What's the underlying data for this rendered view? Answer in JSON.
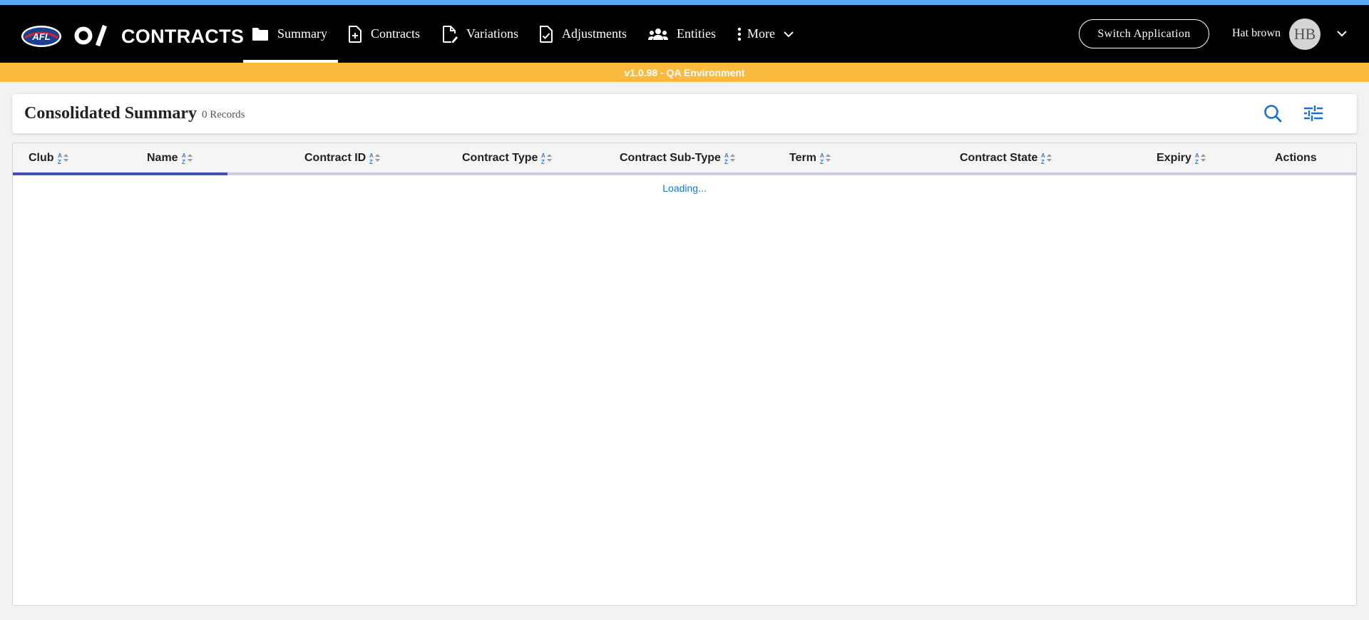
{
  "app": {
    "title": "CONTRACTS",
    "brand_logo_text": "AFL",
    "accent_color": "#5ba9f0",
    "banner_color": "#fbb93d",
    "primary_color": "#3f51b5"
  },
  "nav": {
    "items": [
      {
        "label": "Summary",
        "icon": "folder-icon",
        "active": true
      },
      {
        "label": "Contracts",
        "icon": "file-plus-icon",
        "active": false
      },
      {
        "label": "Variations",
        "icon": "file-edit-icon",
        "active": false
      },
      {
        "label": "Adjustments",
        "icon": "file-check-icon",
        "active": false
      },
      {
        "label": "Entities",
        "icon": "people-icon",
        "active": false
      },
      {
        "label": "More",
        "icon": "more-vert-icon",
        "active": false
      }
    ]
  },
  "header_actions": {
    "switch_application_label": "Switch Application",
    "user_name": "Hat brown",
    "user_initials": "HB"
  },
  "environment_banner": "v1.0.98 - QA Environment",
  "page": {
    "title": "Consolidated Summary",
    "record_count": "0 Records"
  },
  "table": {
    "columns": [
      {
        "label": "Club",
        "sortable": true
      },
      {
        "label": "Name",
        "sortable": true
      },
      {
        "label": "Contract ID",
        "sortable": true
      },
      {
        "label": "Contract Type",
        "sortable": true
      },
      {
        "label": "Contract Sub-Type",
        "sortable": true
      },
      {
        "label": "Term",
        "sortable": true
      },
      {
        "label": "Contract State",
        "sortable": true
      },
      {
        "label": "Expiry",
        "sortable": true
      },
      {
        "label": "Actions",
        "sortable": false
      }
    ],
    "loading_text": "Loading...",
    "loading_progress_percent": 16
  }
}
